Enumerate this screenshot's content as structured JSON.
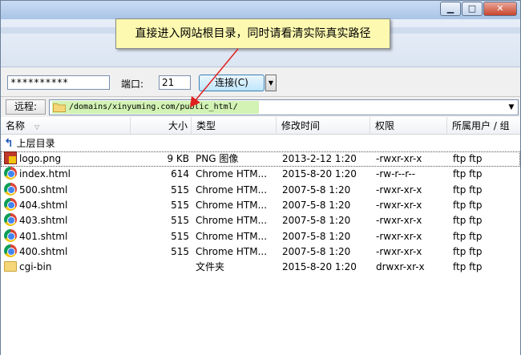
{
  "window": {
    "minimize_glyph": "▁",
    "maximize_glyph": "□",
    "close_glyph": "✕"
  },
  "callout": {
    "text": "直接进入网站根目录，同时请看清实际真实路径"
  },
  "connection": {
    "password_value": "**********",
    "port_label": "端口:",
    "port_value": "21",
    "connect_button": "连接(C)",
    "connect_dropdown_icon": "▼"
  },
  "remote": {
    "label": "远程:",
    "path": "/domains/xinyuming.com/public_html/",
    "folder_icon": "folder-icon",
    "dropdown_icon": "▼"
  },
  "columns": {
    "name": "名称",
    "size": "大小",
    "type": "类型",
    "modified": "修改时间",
    "permissions": "权限",
    "owner": "所属用户 / 组",
    "sort_arrow": "▽"
  },
  "parent_dir": {
    "label": "上层目录",
    "icon": "up-arrow-icon"
  },
  "files": [
    {
      "name": "logo.png",
      "size": "9 KB",
      "type": "PNG 图像",
      "modified": "2013-2-12 1:20",
      "permissions": "-rwxr-xr-x",
      "owner": "ftp ftp",
      "icon": "png-file-icon"
    },
    {
      "name": "index.html",
      "size": "614",
      "type": "Chrome HTM...",
      "modified": "2015-8-20 1:20",
      "permissions": "-rw-r--r--",
      "owner": "ftp ftp",
      "icon": "chrome-html-icon"
    },
    {
      "name": "500.shtml",
      "size": "515",
      "type": "Chrome HTM...",
      "modified": "2007-5-8 1:20",
      "permissions": "-rwxr-xr-x",
      "owner": "ftp ftp",
      "icon": "chrome-html-icon"
    },
    {
      "name": "404.shtml",
      "size": "515",
      "type": "Chrome HTM...",
      "modified": "2007-5-8 1:20",
      "permissions": "-rwxr-xr-x",
      "owner": "ftp ftp",
      "icon": "chrome-html-icon"
    },
    {
      "name": "403.shtml",
      "size": "515",
      "type": "Chrome HTM...",
      "modified": "2007-5-8 1:20",
      "permissions": "-rwxr-xr-x",
      "owner": "ftp ftp",
      "icon": "chrome-html-icon"
    },
    {
      "name": "401.shtml",
      "size": "515",
      "type": "Chrome HTM...",
      "modified": "2007-5-8 1:20",
      "permissions": "-rwxr-xr-x",
      "owner": "ftp ftp",
      "icon": "chrome-html-icon"
    },
    {
      "name": "400.shtml",
      "size": "515",
      "type": "Chrome HTM...",
      "modified": "2007-5-8 1:20",
      "permissions": "-rwxr-xr-x",
      "owner": "ftp ftp",
      "icon": "chrome-html-icon"
    },
    {
      "name": "cgi-bin",
      "size": "",
      "type": "文件夹",
      "modified": "2015-8-20 1:20",
      "permissions": "drwxr-xr-x",
      "owner": "ftp ftp",
      "icon": "folder-icon"
    }
  ],
  "colors": {
    "callout_bg": "#fdf9b0",
    "path_highlight": "#d2f3b4",
    "arrow": "#e02020"
  }
}
